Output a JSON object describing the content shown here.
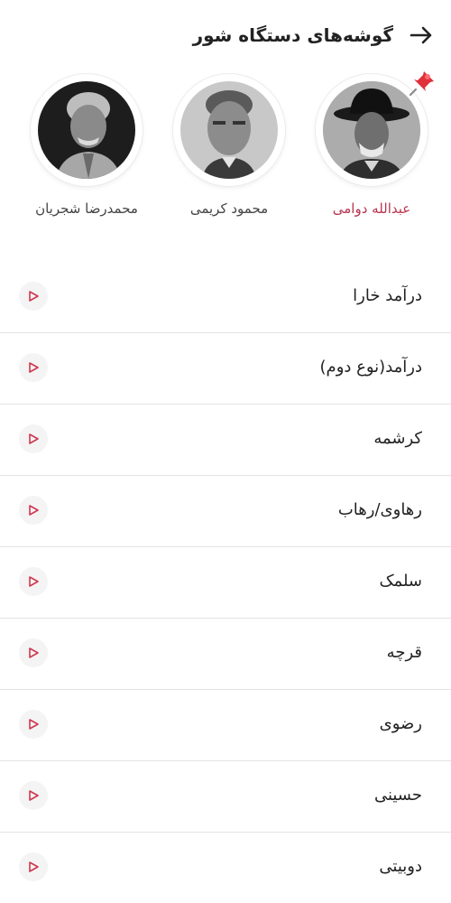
{
  "header": {
    "title": "گوشه‌های دستگاه شور",
    "back_icon": "arrow-right-icon"
  },
  "artists": [
    {
      "name": "عبدالله دوامی",
      "selected": true,
      "pinned": true
    },
    {
      "name": "محمود کریمی",
      "selected": false,
      "pinned": false
    },
    {
      "name": "محمدرضا شجریان",
      "selected": false,
      "pinned": false
    }
  ],
  "gooshe_items": [
    {
      "label": "درآمد خارا"
    },
    {
      "label": "درآمد(نوع دوم)"
    },
    {
      "label": "کرشمه"
    },
    {
      "label": "رهاوی/رهاب"
    },
    {
      "label": "سلمک"
    },
    {
      "label": "قرچه"
    },
    {
      "label": "رضوی"
    },
    {
      "label": "حسینی"
    },
    {
      "label": "دوبیتی"
    }
  ],
  "colors": {
    "accent": "#b9344f",
    "play_icon": "#d0374f",
    "divider": "#e3e3e3"
  }
}
